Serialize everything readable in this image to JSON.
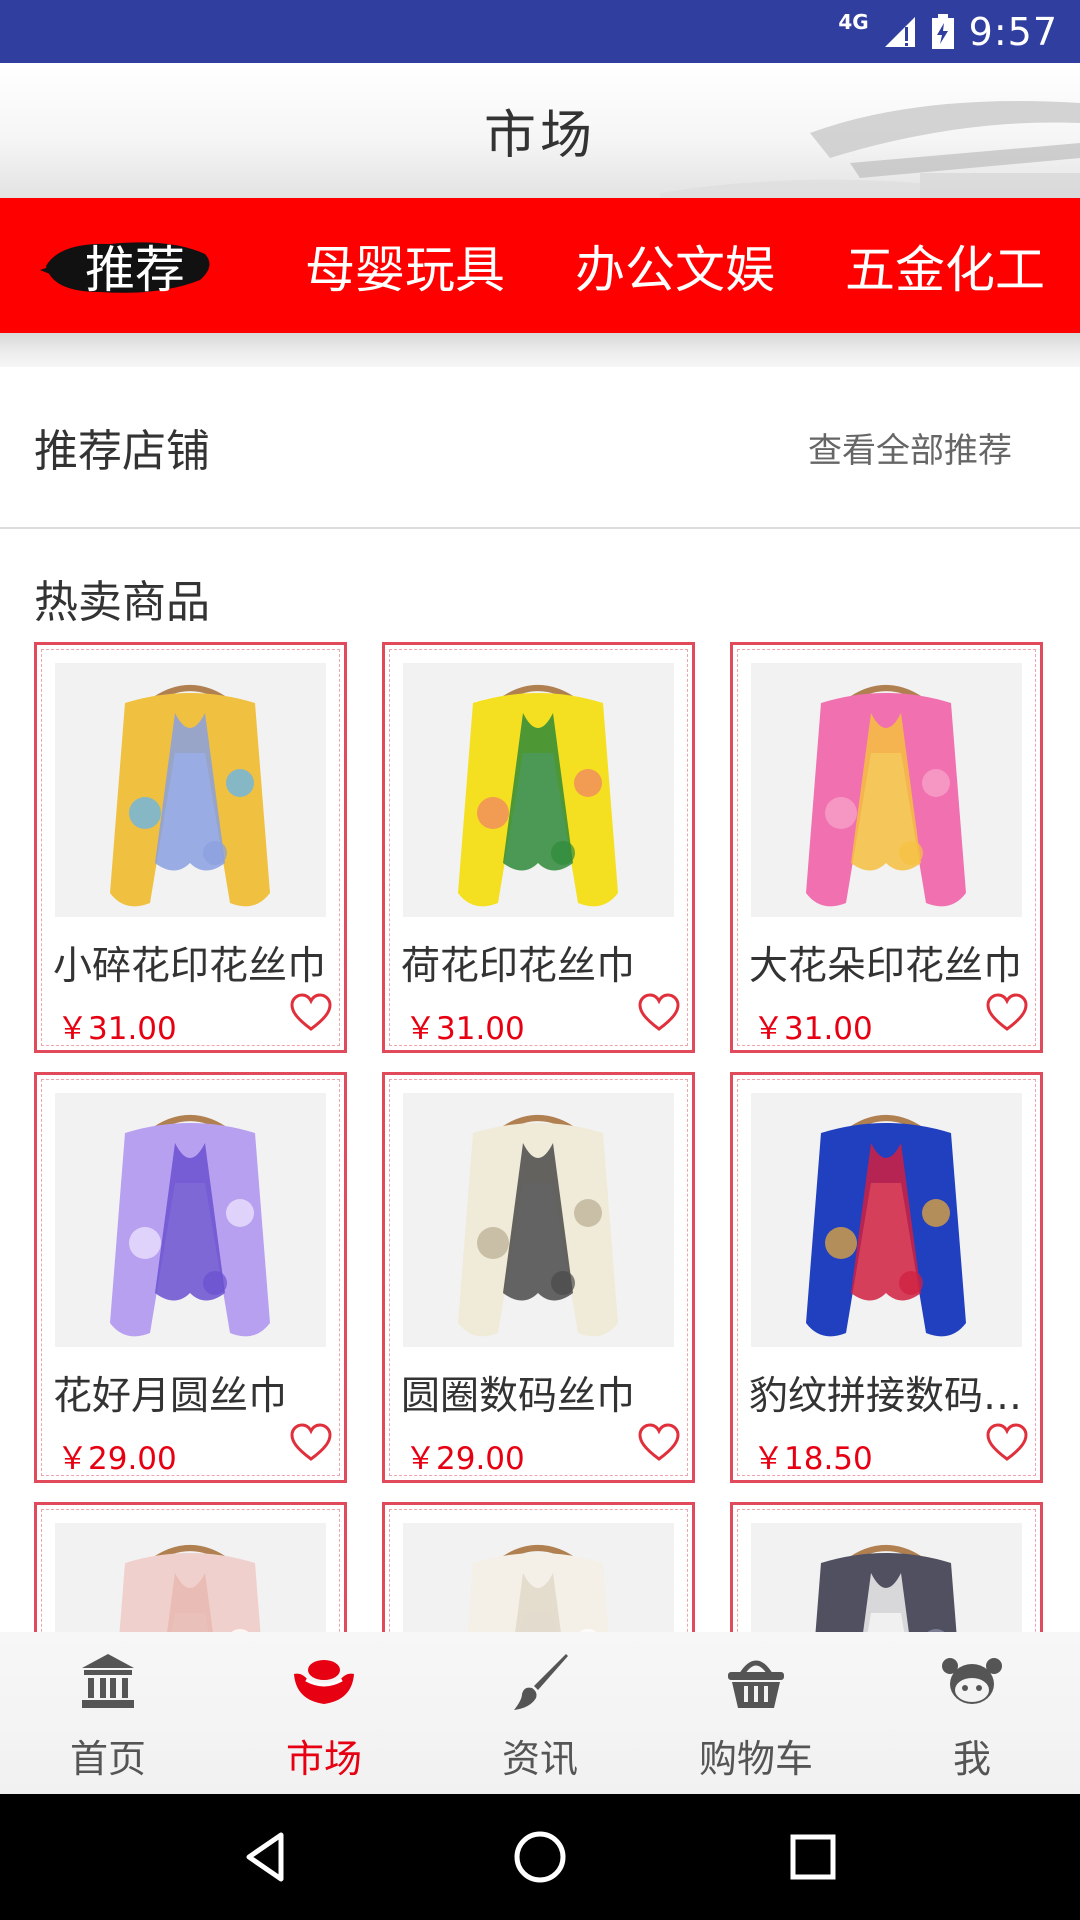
{
  "status_bar": {
    "network": "4G",
    "time": "9:57"
  },
  "header": {
    "title": "市场"
  },
  "tabs": [
    {
      "label": "推荐",
      "active": true
    },
    {
      "label": "母婴玩具",
      "active": false
    },
    {
      "label": "办公文娱",
      "active": false
    },
    {
      "label": "五金化工",
      "active": false
    }
  ],
  "recommended": {
    "title": "推荐店铺",
    "link": "查看全部推荐"
  },
  "hot": {
    "title": "热卖商品"
  },
  "products": [
    {
      "name": "小碎花印花丝巾",
      "price": "￥31.00",
      "colors": [
        "#f0c040",
        "#8aa0e0",
        "#6bb4e6"
      ]
    },
    {
      "name": "荷花印花丝巾",
      "price": "￥31.00",
      "colors": [
        "#f4e020",
        "#2f8a3a",
        "#f08a60"
      ]
    },
    {
      "name": "大花朵印花丝巾",
      "price": "￥31.00",
      "colors": [
        "#f070b0",
        "#f6c040",
        "#f8a0c8"
      ]
    },
    {
      "name": "花好月圆丝巾",
      "price": "￥29.00",
      "colors": [
        "#b8a0f0",
        "#6a50d0",
        "#e8e0ff"
      ]
    },
    {
      "name": "圆圈数码丝巾",
      "price": "￥29.00",
      "colors": [
        "#f0ead8",
        "#4a4a4a",
        "#bfb49a"
      ]
    },
    {
      "name": "豹纹拼接数码丝巾",
      "price": "￥18.50",
      "colors": [
        "#2040c0",
        "#d02040",
        "#d8a040"
      ]
    },
    {
      "name": "",
      "price": "",
      "colors": [
        "#f0d0cc",
        "#e8b8b0",
        "#ffffff"
      ]
    },
    {
      "name": "",
      "price": "",
      "colors": [
        "#f4f0e8",
        "#e0d8c8",
        "#ffffff"
      ]
    },
    {
      "name": "",
      "price": "",
      "colors": [
        "#505060",
        "#f0f0f0",
        "#8888a0"
      ]
    }
  ],
  "bottom_nav": [
    {
      "label": "首页",
      "icon": "bank-icon",
      "active": false
    },
    {
      "label": "市场",
      "icon": "gold-ingot-icon",
      "active": true
    },
    {
      "label": "资讯",
      "icon": "brush-icon",
      "active": false
    },
    {
      "label": "购物车",
      "icon": "basket-icon",
      "active": false
    },
    {
      "label": "我",
      "icon": "kid-face-icon",
      "active": false
    }
  ],
  "theme": {
    "accent": "#ff0000",
    "price": "#e60012",
    "status_bar": "#303f9f"
  }
}
